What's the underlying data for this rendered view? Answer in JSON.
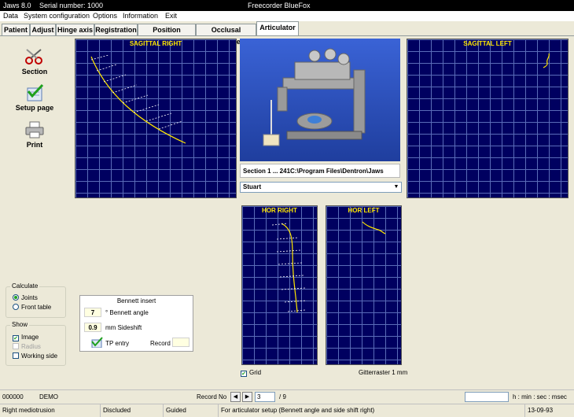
{
  "titlebar": {
    "app": "Jaws 8.0",
    "serial": "Serial number: 1000",
    "center": "Freecorder BlueFox"
  },
  "menu": [
    "Data",
    "System configuration",
    "Options",
    "Information",
    "Exit"
  ],
  "tabs": [
    "Patient",
    "Adjust",
    "Hinge axis",
    "Registration",
    "Position analysis",
    "Occlusal distance",
    "Articulator"
  ],
  "active_tab": "Articulator",
  "sidebar": {
    "section": "Section",
    "setup": "Setup page",
    "print": "Print"
  },
  "plots": {
    "sagittal_right": "SAGITTAL RIGHT",
    "sagittal_left": "SAGITTAL LEFT",
    "hor_right": "HOR RIGHT",
    "hor_left": "HOR LEFT"
  },
  "section_info": "Section    1 ...   241C:\\Program Files\\Dentron\\Jaws",
  "articulator_select": "Stuart",
  "calculate": {
    "label": "Calculate",
    "joints": "Joints",
    "front_table": "Front table"
  },
  "show": {
    "label": "Show",
    "image": "Image",
    "radius": "Radius",
    "working_side": "Working side"
  },
  "bennett": {
    "title": "Bennett insert",
    "angle_value": "7",
    "angle_label": "° Bennett angle",
    "sideshift_value": "0.9",
    "sideshift_label": "mm Sideshift",
    "tp_entry": "TP entry",
    "record": "Record"
  },
  "grid_label": "Grid",
  "raster_label": "Gitterraster 1 mm",
  "status1": {
    "id": "000000",
    "mode": "DEMO",
    "record_no": "Record No",
    "record_value": "3",
    "record_total": "/  9",
    "time_format": "h : min : sec : msec"
  },
  "status2": {
    "movement": "Right mediotrusion",
    "occlusion": "Discluded",
    "guidance": "Guided",
    "hint": "For articulator setup (Bennett angle and side shift right)",
    "date": "13-09-93"
  },
  "colors": {
    "plot_bg": "#000060",
    "trace": "#ffe800",
    "grid": "#5a6cb8"
  }
}
